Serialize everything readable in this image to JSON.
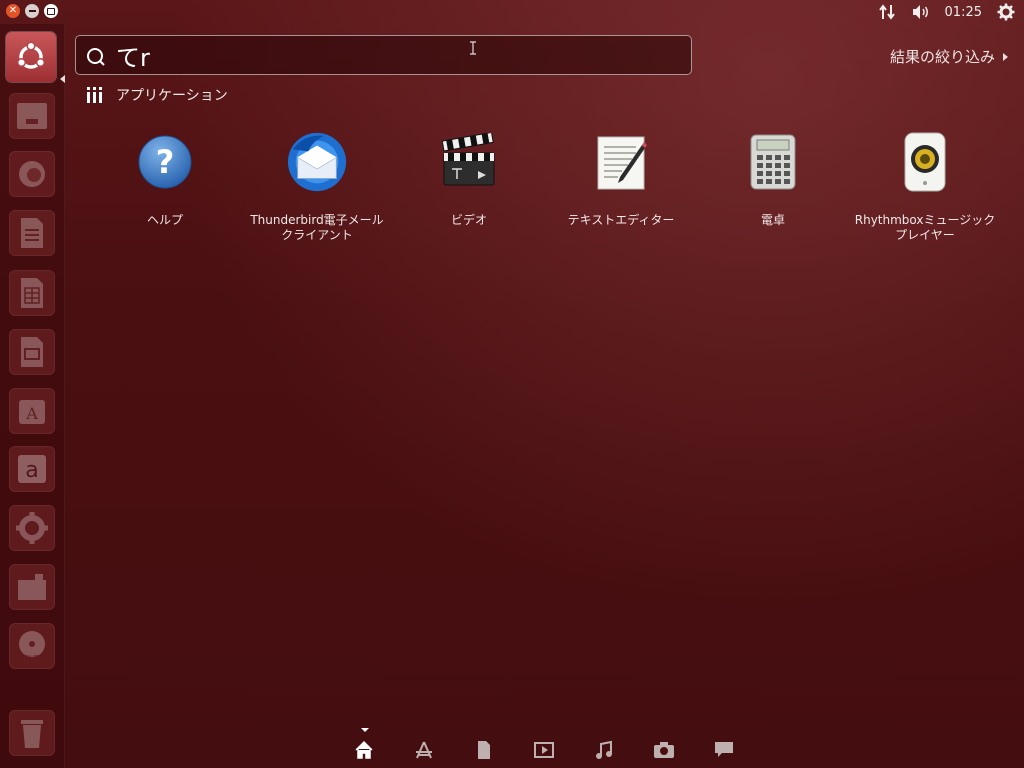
{
  "window_controls": {
    "close": "close-icon",
    "minimize": "minimize-icon",
    "maximize": "maximize-icon"
  },
  "top_panel": {
    "clock": "01:25",
    "network_icon": "network-updown-icon",
    "volume_icon": "volume-icon",
    "settings_icon": "gear-icon"
  },
  "launcher": {
    "items": [
      {
        "name": "dash-home",
        "icon": "ubuntu-logo-icon"
      },
      {
        "name": "files",
        "icon": "file-manager-icon"
      },
      {
        "name": "firefox",
        "icon": "browser-icon"
      },
      {
        "name": "writer",
        "icon": "writer-icon"
      },
      {
        "name": "calc",
        "icon": "spreadsheet-icon"
      },
      {
        "name": "impress",
        "icon": "presentation-icon"
      },
      {
        "name": "software-center",
        "icon": "software-center-icon"
      },
      {
        "name": "amazon",
        "icon": "amazon-icon"
      },
      {
        "name": "system-settings",
        "icon": "settings-icon"
      },
      {
        "name": "workspace",
        "icon": "workspace-icon"
      },
      {
        "name": "dvd",
        "icon": "dvd-icon"
      },
      {
        "name": "trash",
        "icon": "trash-icon"
      }
    ]
  },
  "search": {
    "value": "てr",
    "placeholder": ""
  },
  "filter": {
    "label": "結果の絞り込み"
  },
  "category": {
    "label": "アプリケーション",
    "icon": "applications-icon"
  },
  "apps": [
    {
      "label_line1": "ヘルプ",
      "label_line2": "",
      "icon": "help-icon"
    },
    {
      "label_line1": "Thunderbird電子メール",
      "label_line2": "クライアント",
      "icon": "thunderbird-icon"
    },
    {
      "label_line1": "ビデオ",
      "label_line2": "",
      "icon": "video-clapper-icon"
    },
    {
      "label_line1": "テキストエディター",
      "label_line2": "",
      "icon": "text-editor-icon"
    },
    {
      "label_line1": "電卓",
      "label_line2": "",
      "icon": "calculator-icon"
    },
    {
      "label_line1": "Rhythmboxミュージック",
      "label_line2": "プレイヤー",
      "icon": "speaker-icon"
    }
  ],
  "lenses": [
    {
      "name": "home",
      "icon": "home-icon",
      "active": true
    },
    {
      "name": "applications",
      "icon": "applications-lens-icon",
      "active": false
    },
    {
      "name": "files",
      "icon": "file-icon",
      "active": false
    },
    {
      "name": "video",
      "icon": "video-icon",
      "active": false
    },
    {
      "name": "music",
      "icon": "music-icon",
      "active": false
    },
    {
      "name": "photos",
      "icon": "camera-icon",
      "active": false
    },
    {
      "name": "social",
      "icon": "chat-icon",
      "active": false
    }
  ],
  "colors": {
    "background": "#4a0e10",
    "close_button": "#e25328",
    "launcher_active": "#b3454a"
  }
}
